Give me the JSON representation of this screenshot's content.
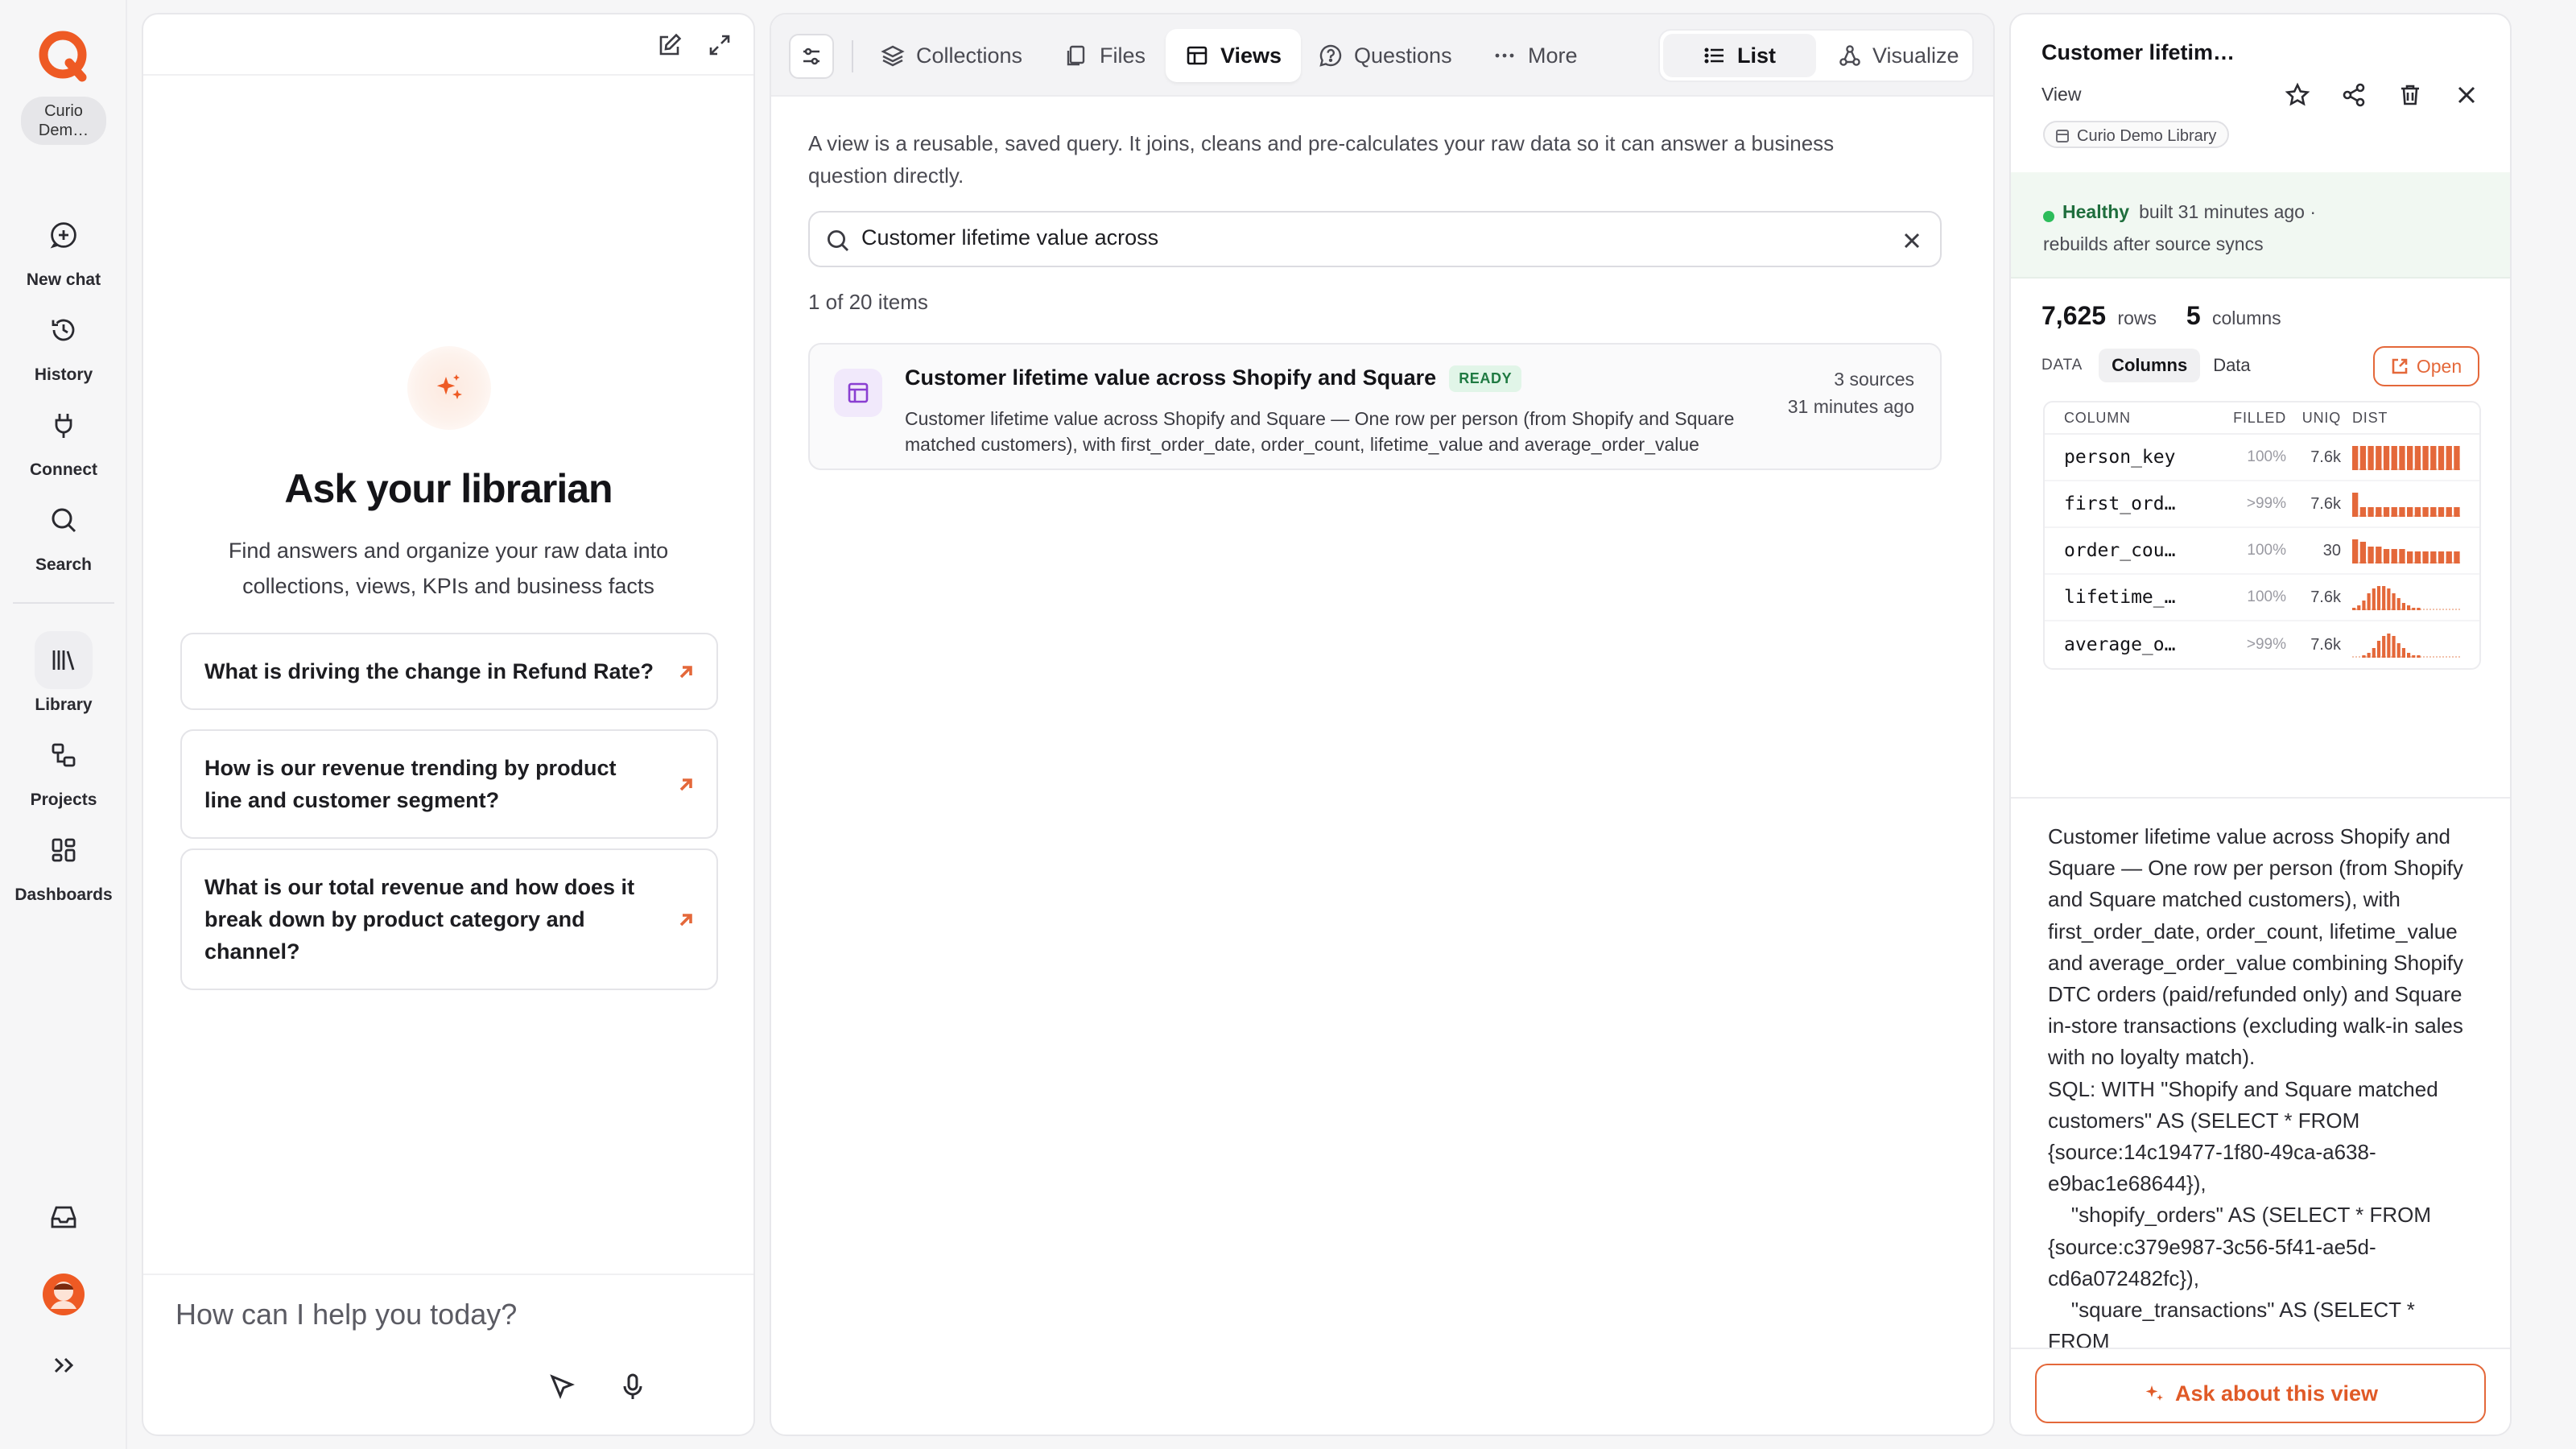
{
  "rail": {
    "workspace": "Curio Dem…",
    "items": [
      {
        "label": "New chat",
        "icon": "new-chat-icon"
      },
      {
        "label": "History",
        "icon": "history-icon"
      },
      {
        "label": "Connect",
        "icon": "plug-icon"
      },
      {
        "label": "Search",
        "icon": "search-icon"
      },
      {
        "label": "Library",
        "icon": "library-icon",
        "active": true
      },
      {
        "label": "Projects",
        "icon": "projects-icon"
      },
      {
        "label": "Dashboards",
        "icon": "dashboards-icon"
      }
    ],
    "bottom_icons": [
      "inbox-icon",
      "avatar",
      "expand-rail-icon"
    ]
  },
  "chat": {
    "title": "Ask your librarian",
    "subtitle": "Find answers and organize your raw data into collections, views, KPIs and business facts",
    "suggestions": [
      "What is driving the change in Refund Rate?",
      "How is our revenue trending by product line and customer segment?",
      "What is our total revenue and how does it break down by product category and channel?"
    ],
    "input_placeholder": "How can I help you today?"
  },
  "main": {
    "tabs": [
      "Collections",
      "Files",
      "Views",
      "Questions",
      "More"
    ],
    "active_tab": "Views",
    "view_modes": [
      "List",
      "Visualize"
    ],
    "active_mode": "List",
    "intro": "A view is a reusable, saved query. It joins, cleans and pre-calculates your raw data so it can answer a business question directly.",
    "search_value": "Customer lifetime value across",
    "count": "1 of 20 items",
    "results": [
      {
        "title": "Customer lifetime value across Shopify and Square",
        "badge": "READY",
        "description": "Customer lifetime value across Shopify and Square — One row per person (from Shopify and Square matched customers), with first_order_date, order_count, lifetime_value and average_order_value combining Shopify…",
        "sources": "3 sources",
        "time": "31 minutes ago"
      }
    ]
  },
  "detail": {
    "title": "Customer lifetim…",
    "kind": "View",
    "library": "Curio Demo Library",
    "health_status": "Healthy",
    "built": "built 31 minutes ago",
    "sep": "·",
    "rebuild": "rebuilds after source syncs",
    "rows": "7,625",
    "rows_label": "rows",
    "columns": "5",
    "columns_label": "columns",
    "data_label": "DATA",
    "tabs": [
      "Columns",
      "Data"
    ],
    "open_label": "Open",
    "table_headers": [
      "COLUMN",
      "FILLED",
      "UNIQ",
      "DIST"
    ],
    "column_rows": [
      {
        "name": "person_key",
        "filled": "100%",
        "uniq": "7.6k",
        "dist": [
          10,
          10,
          10,
          10,
          10,
          10,
          10,
          10,
          10,
          10,
          10,
          10,
          10,
          10
        ]
      },
      {
        "name": "first_ord…",
        "filled": ">99%",
        "uniq": "7.6k",
        "dist": [
          10,
          4,
          4,
          4,
          4,
          4,
          4,
          4,
          4,
          4,
          4,
          4,
          4,
          4
        ]
      },
      {
        "name": "order_cou…",
        "filled": "100%",
        "uniq": "30",
        "dist": [
          10,
          9,
          7,
          7,
          6,
          6,
          6,
          5,
          5,
          5,
          5,
          5,
          5,
          5
        ]
      },
      {
        "name": "lifetime_…",
        "filled": "100%",
        "uniq": "7.6k",
        "dist": [
          1,
          2,
          4,
          7,
          9,
          10,
          10,
          9,
          7,
          5,
          3,
          2,
          1,
          1,
          0,
          0,
          0,
          0,
          0,
          0,
          0,
          0
        ]
      },
      {
        "name": "average_o…",
        "filled": ">99%",
        "uniq": "7.6k",
        "dist": [
          0,
          0,
          1,
          2,
          4,
          7,
          9,
          10,
          9,
          6,
          4,
          2,
          1,
          1,
          0,
          0,
          0,
          0,
          0,
          0,
          0,
          0
        ]
      }
    ],
    "description": "Customer lifetime value across Shopify and Square — One row per person (from Shopify and Square matched customers), with first_order_date, order_count, lifetime_value and average_order_value combining Shopify DTC orders (paid/refunded only) and Square in-store transactions (excluding walk-in sales with no loyalty match).\nSQL: WITH \"Shopify and Square matched customers\" AS (SELECT * FROM {source:14c19477-1f80-49ca-a638-e9bac1e68644}),\n    \"shopify_orders\" AS (SELECT * FROM {source:c379e987-3c56-5f41-ae5d-cd6a072482fc}),\n    \"square_transactions\" AS (SELECT * FROM",
    "ask_label": "Ask about this view"
  },
  "colors": {
    "accent": "#e4683a",
    "healthy": "#2dbd5b",
    "ready_badge_bg": "#e1f5e8",
    "ready_badge_text": "#1f7a42"
  }
}
